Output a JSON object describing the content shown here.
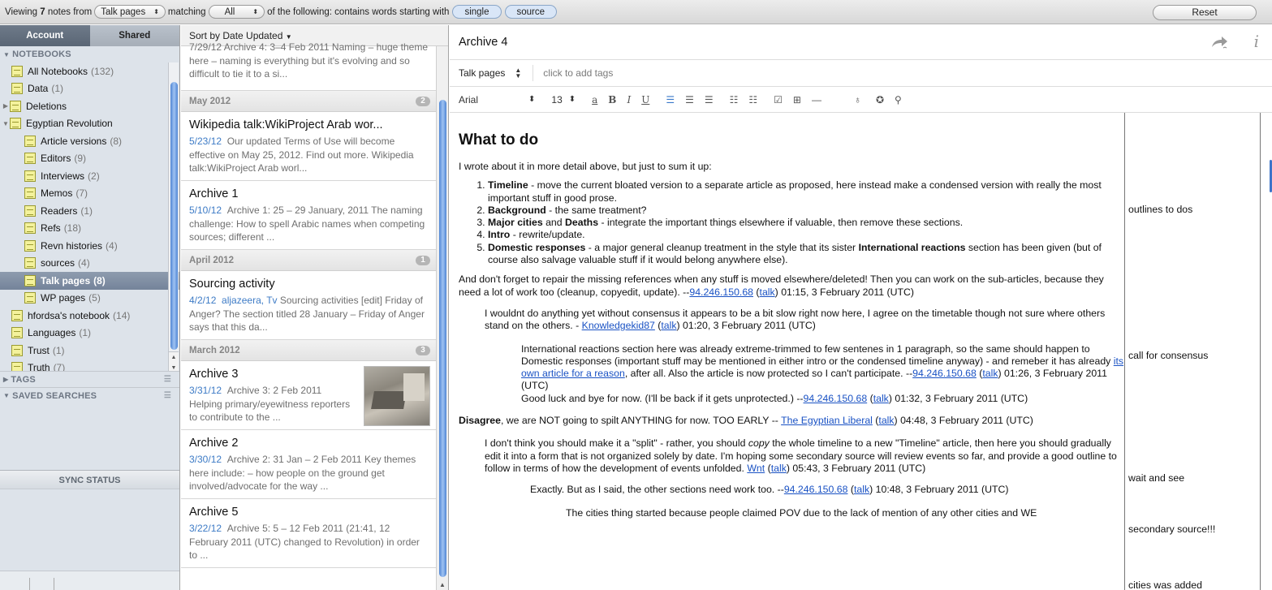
{
  "topbar": {
    "viewing_prefix": "Viewing",
    "count": "7",
    "notes_from": "notes from",
    "scope": "Talk pages",
    "matching": "matching",
    "match_mode": "All",
    "of_following": "of the following: contains words starting with",
    "terms": [
      "single",
      "source"
    ],
    "reset": "Reset"
  },
  "sidebar": {
    "tabs": [
      "Account",
      "Shared"
    ],
    "notebooks_header": "NOTEBOOKS",
    "notebooks": [
      {
        "name": "All Notebooks",
        "count": "(132)"
      },
      {
        "name": "Data",
        "count": "(1)"
      },
      {
        "name": "Deletions",
        "count": ""
      },
      {
        "name": "Egyptian Revolution",
        "count": ""
      },
      {
        "name": "Article versions",
        "count": "(8)"
      },
      {
        "name": "Editors",
        "count": "(9)"
      },
      {
        "name": "Interviews",
        "count": "(2)"
      },
      {
        "name": "Memos",
        "count": "(7)"
      },
      {
        "name": "Readers",
        "count": "(1)"
      },
      {
        "name": "Refs",
        "count": "(18)"
      },
      {
        "name": "Revn histories",
        "count": "(4)"
      },
      {
        "name": "sources",
        "count": "(4)"
      },
      {
        "name": "Talk pages",
        "count": "(8)"
      },
      {
        "name": "WP pages",
        "count": "(5)"
      },
      {
        "name": "hfordsa's notebook",
        "count": "(14)"
      },
      {
        "name": "Languages",
        "count": "(1)"
      },
      {
        "name": "Trust",
        "count": "(1)"
      },
      {
        "name": "Truth",
        "count": "(7)"
      }
    ],
    "tags_header": "TAGS",
    "saved_header": "SAVED SEARCHES",
    "sync_header": "SYNC STATUS"
  },
  "notelist": {
    "sort_label": "Sort by Date Updated",
    "first_snippet_head": "7/29/12  Archive 4: 3–4 Feb 2011 Naming –",
    "first_snippet": "huge theme here – naming is everything but it's evolving and so difficult to tie it to a si...",
    "groups": [
      {
        "label": "May 2012",
        "count": "2"
      },
      {
        "label": "April 2012",
        "count": "1"
      },
      {
        "label": "March 2012",
        "count": "3"
      }
    ],
    "notes": [
      {
        "title": "Wikipedia talk:WikiProject Arab wor...",
        "date": "5/23/12",
        "snippet": "Our updated Terms of Use will become effective on May 25, 2012. Find out more. Wikipedia talk:WikiProject Arab worl..."
      },
      {
        "title": "Archive 1",
        "date": "5/10/12",
        "snippet": "Archive 1: 25 – 29 January, 2011 The naming challenge: How to spell Arabic names when competing sources; different ..."
      },
      {
        "title": "Sourcing activity",
        "date": "4/2/12",
        "snippet_blue": "aljazeera, Tv",
        "snippet": "Sourcing activities [edit] Friday of Anger? The section titled 28 January – Friday of Anger says that this da..."
      },
      {
        "title": "Archive 3",
        "date": "3/31/12",
        "snippet": "Archive 3: 2 Feb 2011 Helping primary/eyewitness reporters to contribute to the ..."
      },
      {
        "title": "Archive 2",
        "date": "3/30/12",
        "snippet": "Archive 2: 31 Jan – 2 Feb 2011 Key themes here include: – how people on the ground get involved/advocate for the way ..."
      },
      {
        "title": "Archive 5",
        "date": "3/22/12",
        "snippet": "Archive 5: 5 – 12 Feb 2011 (21:41, 12 February 2011 (UTC) changed to Revolution) in order to ..."
      }
    ]
  },
  "editor": {
    "title": "Archive 4",
    "notebook": "Talk pages",
    "tags_placeholder": "click to add tags",
    "font": "Arial",
    "size": "13",
    "heading": "What to do",
    "intro": "I wrote about it in more detail above, but just to sum it up:",
    "list": [
      {
        "b": "Timeline",
        "t": " - move the current bloated version to a separate article as proposed, here instead make a condensed version with really the most important stuff in good prose."
      },
      {
        "b": "Background",
        "t": " - the same treatment?"
      },
      {
        "b": "Major cities",
        "m": " and ",
        "b2": "Deaths",
        "t": " - integrate the important things elsewhere if valuable, then remove these sections."
      },
      {
        "b": "Intro",
        "t": " - rewrite/update."
      },
      {
        "b": "Domestic responses",
        "t": " - a major general cleanup treatment in the style that its sister ",
        "b2": "International reactions",
        "t2": " section has been given (but of course also salvage valuable stuff if it would belong anywhere else)."
      }
    ],
    "p_repair": "And don't forget to repair the missing references when any stuff is moved elsewhere/deleted! Then you can work on the sub-articles, because they need a lot of work too (cleanup, copyedit, update). --",
    "ip": "94.246.150.68",
    "talk": "talk",
    "ts1": " 01:15, 3 February 2011 (UTC)",
    "p_wouldnt": "I wouldnt do anything yet without consensus it appears to be a bit slow right now here, I agree on the timetable though not sure where others stand on the others. - ",
    "user_knowledge": "Knowledgekid87",
    "ts2": " 01:20, 3 February 2011 (UTC)",
    "p_intl": "International reactions section here was already extreme-trimmed to few sentenes in 1 paragraph, so the same should happen to Domestic responses (important stuff may be mentioned in either intro or the condensed timeline anyway) - and remeber it has already ",
    "link_own": "its own article for a reason",
    "p_intl2": ", after all. Also the article is now protected so I can't participate. --",
    "ts3": " 01:26, 3 February 2011 (UTC)",
    "p_goodluck": "Good luck and bye for now. (I'll be back if it gets unprotected.) --",
    "ts4": " 01:32, 3 February 2011 (UTC)",
    "disagree_b": "Disagree",
    "disagree": ", we are NOT going to spilt ANYTHING for now. TOO EARLY -- ",
    "user_liberal": "The Egyptian Liberal",
    "ts5": " 04:48, 3 February 2011 (UTC)",
    "p_split1": "I don't think you should make it a \"split\" - rather, you should ",
    "p_split_em": "copy",
    "p_split2": " the whole timeline to a new \"Timeline\" article, then here you should gradually edit it into a form that is not organized solely by date. I'm hoping some secondary source will review events so far, and provide a good outline to follow in terms of how the development of events unfolded. ",
    "user_wnt": "Wnt",
    "ts6": " 05:43, 3 February 2011 (UTC)",
    "p_exactly": "Exactly. But as I said, the other sections need work too. --",
    "ts7": " 10:48, 3 February 2011 (UTC)",
    "p_cities": "The cities thing started because people claimed POV due to the lack of mention of any other cities and WE",
    "margin_notes": [
      "outlines to dos",
      "call for consensus",
      "wait and see",
      "secondary source!!!",
      "cities was added"
    ]
  }
}
